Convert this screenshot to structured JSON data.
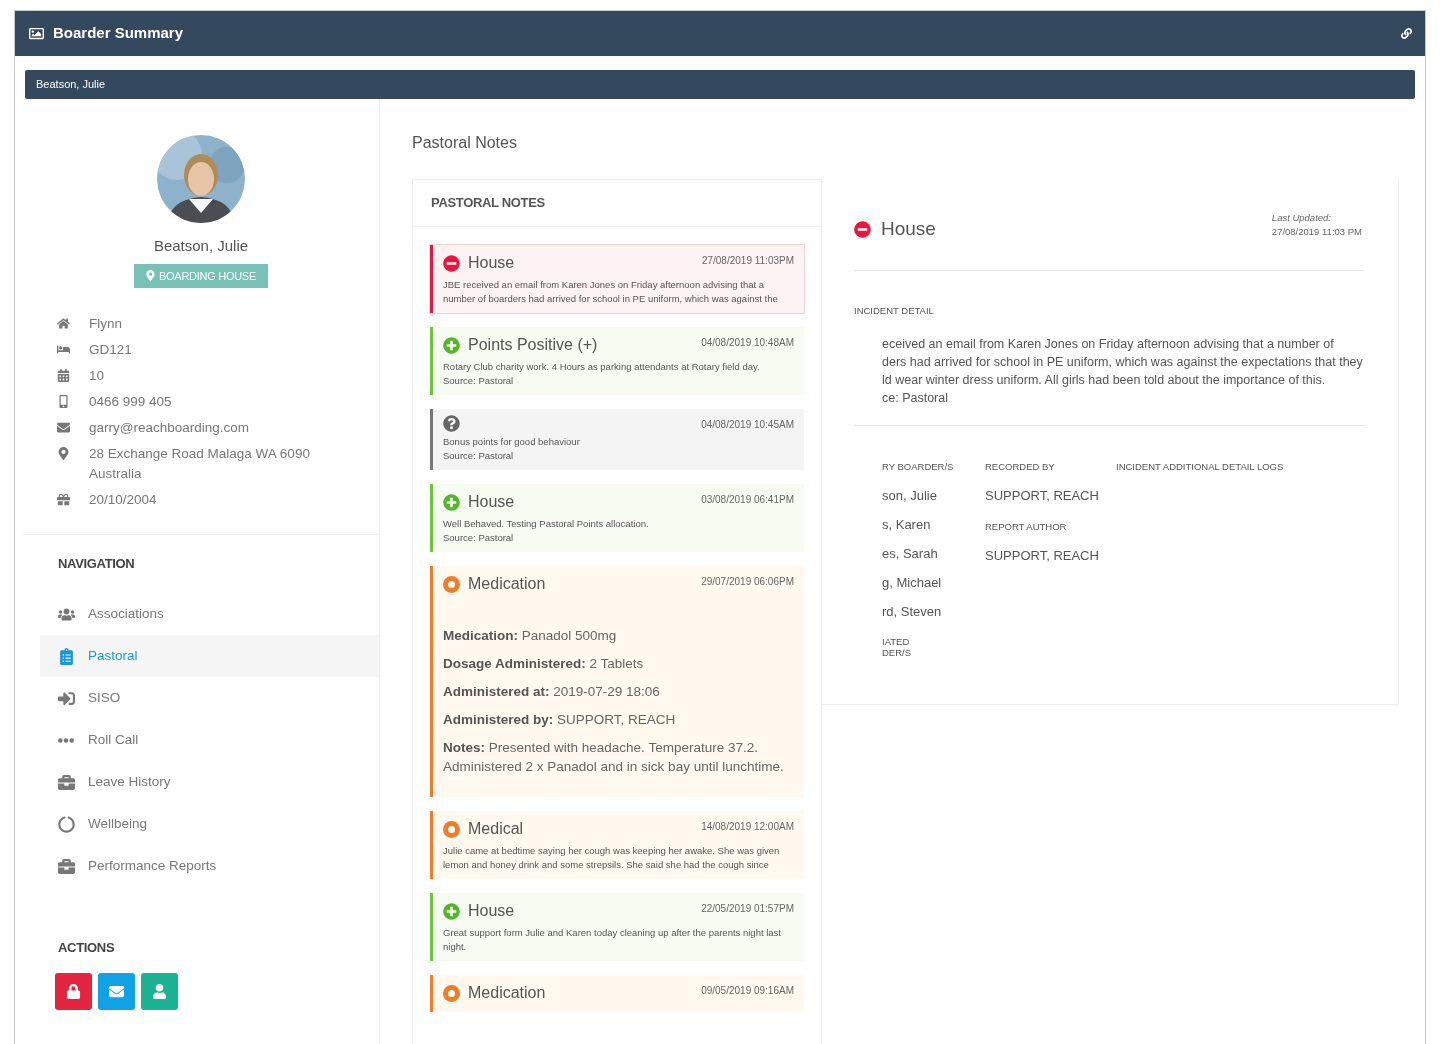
{
  "window": {
    "title": "Boarder Summary"
  },
  "selector": {
    "value": "Beatson, Julie"
  },
  "profile": {
    "name": "Beatson, Julie",
    "badge": "BOARDING HOUSE",
    "details": [
      {
        "kind": "house",
        "lines": [
          "Flynn"
        ]
      },
      {
        "kind": "room",
        "lines": [
          "GD121"
        ]
      },
      {
        "kind": "year",
        "lines": [
          "10"
        ]
      },
      {
        "kind": "phone",
        "lines": [
          "0466 999 405"
        ]
      },
      {
        "kind": "email",
        "lines": [
          "garry@reachboarding.com"
        ]
      },
      {
        "kind": "address",
        "lines": [
          "28 Exchange Road Malaga WA 6090",
          "Australia"
        ]
      },
      {
        "kind": "birthday",
        "lines": [
          "20/10/2004"
        ]
      }
    ]
  },
  "navigation": {
    "title": "NAVIGATION",
    "items": [
      {
        "label": "Associations",
        "kind": "people",
        "selected": false
      },
      {
        "label": "Pastoral",
        "kind": "clipboard",
        "selected": true
      },
      {
        "label": "SISO",
        "kind": "signin",
        "selected": false
      },
      {
        "label": "Roll Call",
        "kind": "dots",
        "selected": false
      },
      {
        "label": "Leave History",
        "kind": "briefcase",
        "selected": false
      },
      {
        "label": "Wellbeing",
        "kind": "ring",
        "selected": false
      },
      {
        "label": "Performance Reports",
        "kind": "briefcase",
        "selected": false
      }
    ]
  },
  "actions": {
    "title": "ACTIONS",
    "buttons": [
      {
        "kind": "lock",
        "color": "#e3253f"
      },
      {
        "kind": "mail",
        "color": "#10a2e4"
      },
      {
        "kind": "user",
        "color": "#1bb394"
      }
    ]
  },
  "page_title": "Pastoral Notes",
  "notes": {
    "title": "PASTORAL NOTES",
    "items": [
      {
        "kind": "negative",
        "title": "House",
        "date": "27/08/2019 11:03PM",
        "lines": [
          "JBE received an email from Karen Jones on Friday afternoon advising that a number of boarders had arrived for school in PE uniform, which was against the"
        ],
        "selected": true
      },
      {
        "kind": "positive",
        "title": "Points Positive (+)",
        "date": "04/08/2019 10:48AM",
        "lines": [
          "Rotary Club charity work. 4 Hours as parking attendants at Rotary field day.",
          "Source: Pastoral"
        ],
        "selected": false
      },
      {
        "kind": "neutral",
        "date": "04/08/2019 10:45AM",
        "lines": [
          "Bonus points for good behaviour",
          "Source: Pastoral"
        ],
        "selected": false
      },
      {
        "kind": "positive",
        "title": "House",
        "date": "03/08/2019 06:41PM",
        "lines": [
          "Well Behaved. Testing Pastoral Points allocation.",
          "Source: Pastoral"
        ],
        "selected": false
      },
      {
        "kind": "medication",
        "title": "Medication",
        "date": "29/07/2019 06:06PM",
        "fields": [
          "**Medication:** Panadol 500mg",
          "**Dosage Administered:** 2 Tablets",
          "**Administered at:** 2019-07-29 18:06",
          "**Administered by:** SUPPORT, REACH",
          "**Notes:** Presented with headache. Temperature 37.2. Administered 2 x Panadol and in sick bay until lunchtime."
        ],
        "selected": false
      },
      {
        "kind": "medication",
        "title": "Medical",
        "date": "14/08/2019 12:00AM",
        "lines": [
          "Julie came at bedtime saying her cough was keeping her awake. She was given lemon and honey drink and some strepsils. She said she had the cough since"
        ],
        "selected": false
      },
      {
        "kind": "positive",
        "title": "House",
        "date": "22/05/2019 01:57PM",
        "lines": [
          "Great support form Julie and Karen today cleaning up after the parents night last night."
        ],
        "selected": false
      },
      {
        "kind": "medication",
        "title": "Medication",
        "date": "09/05/2019 09:16AM",
        "selected": false
      }
    ]
  },
  "detail": {
    "kind": "negative",
    "title": "House",
    "updated_label": "Last Updated:",
    "updated": "27/08/2019 11:03 PM",
    "incident_label": "INCIDENT DETAIL",
    "incident_lines": [
      "eceived an email from Karen Jones on Friday afternoon advising that a number of",
      "ders had arrived for school in PE uniform, which was against the expectations that they",
      "ld wear winter dress uniform. All girls had been told about the importance of this.",
      "ce: Pastoral"
    ],
    "boarders_label": "RY BOARDER/S",
    "boarders": [
      "son, Julie",
      "s, Karen",
      "es, Sarah",
      "g, Michael",
      "rd, Steven"
    ],
    "associated_label": [
      "IATED",
      "DER/S"
    ],
    "recorded_by_label": "RECORDED BY",
    "recorded_by": "SUPPORT, REACH",
    "report_author_label": "REPORT AUTHOR",
    "report_author": "SUPPORT, REACH",
    "logs_label": "INCIDENT ADDITIONAL DETAIL LOGS"
  }
}
